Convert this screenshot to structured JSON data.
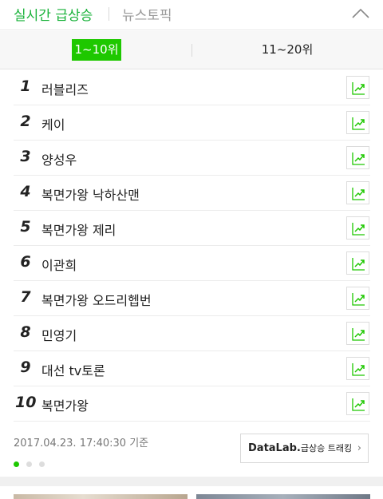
{
  "header": {
    "active_tab": "실시간 급상승",
    "inactive_tab": "뉴스토픽",
    "collapse_icon": "chevron-up-icon"
  },
  "range_tabs": {
    "active": "1~10위",
    "inactive": "11~20위"
  },
  "rankings": [
    {
      "rank": "1",
      "keyword": "러블리즈"
    },
    {
      "rank": "2",
      "keyword": "케이"
    },
    {
      "rank": "3",
      "keyword": "양성우"
    },
    {
      "rank": "4",
      "keyword": "복면가왕 낙하산맨"
    },
    {
      "rank": "5",
      "keyword": "복면가왕 제리"
    },
    {
      "rank": "6",
      "keyword": "이관희"
    },
    {
      "rank": "7",
      "keyword": "복면가왕 오드리헵번"
    },
    {
      "rank": "8",
      "keyword": "민영기"
    },
    {
      "rank": "9",
      "keyword": "대선 tv토론"
    },
    {
      "rank": "10",
      "keyword": "복면가왕"
    }
  ],
  "trend_icon": "trend-chart-icon",
  "footer": {
    "timestamp": "2017.04.23. 17:40:30 기준",
    "datalab_brand": "DataLab.",
    "datalab_sub": "급상승 트래킹",
    "datalab_chevron": "›",
    "page_dots_total": 3,
    "page_dots_active": 1
  },
  "colors": {
    "accent": "#1ec800",
    "active_tab_text": "#19b23a"
  }
}
